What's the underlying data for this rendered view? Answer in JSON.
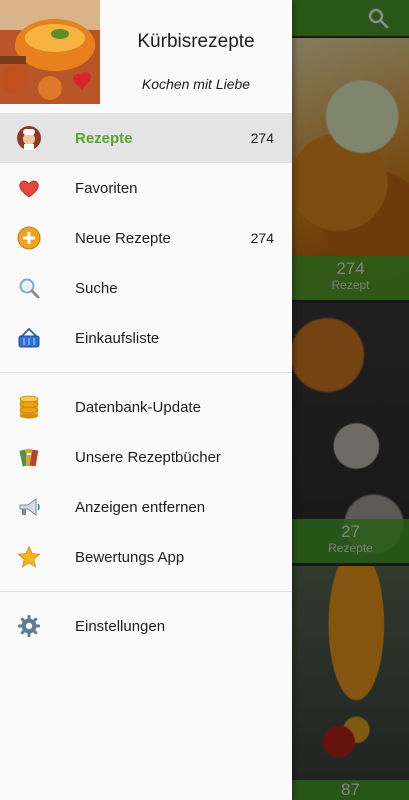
{
  "header": {
    "title": "Kürbisrezepte",
    "subtitle": "Kochen mit Liebe"
  },
  "menu_primary": [
    {
      "label": "Rezepte",
      "count": "274",
      "icon": "chef-icon",
      "active": true
    },
    {
      "label": "Favoriten",
      "count": "",
      "icon": "heart-icon",
      "active": false
    },
    {
      "label": "Neue Rezepte",
      "count": "274",
      "icon": "plus-circle-icon",
      "active": false
    },
    {
      "label": "Suche",
      "count": "",
      "icon": "magnifier-icon",
      "active": false
    },
    {
      "label": "Einkaufsliste",
      "count": "",
      "icon": "shopping-basket-icon",
      "active": false
    }
  ],
  "menu_secondary": [
    {
      "label": "Datenbank-Update",
      "icon": "database-icon"
    },
    {
      "label": "Unsere Rezeptbücher",
      "icon": "books-icon"
    },
    {
      "label": "Anzeigen entfernen",
      "icon": "megaphone-icon"
    },
    {
      "label": "Bewertungs App",
      "icon": "star-icon"
    }
  ],
  "menu_tertiary": [
    {
      "label": "Einstellungen",
      "icon": "gear-icon"
    }
  ],
  "background_cards": [
    {
      "count": "274",
      "label": "Rezept"
    },
    {
      "count": "27",
      "label": "Rezepte"
    },
    {
      "count": "87",
      "label": ""
    }
  ],
  "colors": {
    "accent": "#5aa52e",
    "appbar": "#4a9f2c",
    "drawer_bg": "#fafafa",
    "active_bg": "#e4e4e4"
  }
}
